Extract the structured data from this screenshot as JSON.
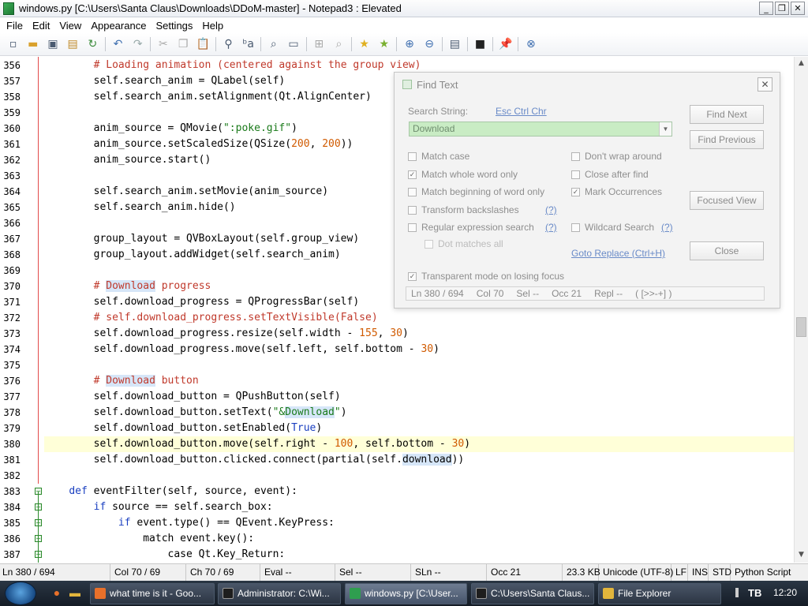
{
  "window": {
    "title": "windows.py [C:\\Users\\Santa Claus\\Downloads\\DDoM-master] - Notepad3 : Elevated",
    "buttons": [
      "_",
      "❐",
      "✕"
    ]
  },
  "menu": [
    "File",
    "Edit",
    "View",
    "Appearance",
    "Settings",
    "Help"
  ],
  "toolbar_icons": [
    "new-icon",
    "open-icon",
    "save-icon",
    "save-all-icon",
    "reload-icon",
    "undo-icon",
    "redo-icon",
    "cut-icon",
    "copy-icon",
    "paste-icon",
    "find-icon",
    "replace-icon",
    "zoom-find-icon",
    "wrap-icon",
    "goto-icon",
    "favorites-icon",
    "add-favorite-icon",
    "zoom-in-icon",
    "zoom-out-icon",
    "scheme-icon",
    "console-icon",
    "pin-icon",
    "close-doc-icon"
  ],
  "editor": {
    "lines": [
      {
        "n": "356",
        "segs": [
          {
            "t": "        "
          },
          {
            "t": "# Loading animation (centered against the group view)",
            "c": "cm"
          }
        ]
      },
      {
        "n": "357",
        "segs": [
          {
            "t": "        self.search_anim = QLabel(self)"
          }
        ]
      },
      {
        "n": "358",
        "segs": [
          {
            "t": "        self.search_anim.setAlignment(Qt.AlignCenter)"
          }
        ]
      },
      {
        "n": "359",
        "segs": []
      },
      {
        "n": "360",
        "segs": [
          {
            "t": "        anim_source = QMovie("
          },
          {
            "t": "\":poke.gif\"",
            "c": "st"
          },
          {
            "t": ")"
          }
        ]
      },
      {
        "n": "361",
        "segs": [
          {
            "t": "        anim_source.setScaledSize(QSize("
          },
          {
            "t": "200",
            "c": "nm"
          },
          {
            "t": ", "
          },
          {
            "t": "200",
            "c": "nm"
          },
          {
            "t": "))"
          }
        ]
      },
      {
        "n": "362",
        "segs": [
          {
            "t": "        anim_source.start()"
          }
        ]
      },
      {
        "n": "363",
        "segs": []
      },
      {
        "n": "364",
        "segs": [
          {
            "t": "        self.search_anim.setMovie(anim_source)"
          }
        ]
      },
      {
        "n": "365",
        "segs": [
          {
            "t": "        self.search_anim.hide()"
          }
        ]
      },
      {
        "n": "366",
        "segs": []
      },
      {
        "n": "367",
        "segs": [
          {
            "t": "        group_layout = QVBoxLayout(self.group_view)"
          }
        ]
      },
      {
        "n": "368",
        "segs": [
          {
            "t": "        group_layout.addWidget(self.search_anim)"
          }
        ]
      },
      {
        "n": "369",
        "segs": []
      },
      {
        "n": "370",
        "segs": [
          {
            "t": "        "
          },
          {
            "t": "# ",
            "c": "cm"
          },
          {
            "t": "Download",
            "c": "cm hl"
          },
          {
            "t": " progress",
            "c": "cm"
          }
        ]
      },
      {
        "n": "371",
        "segs": [
          {
            "t": "        self.download_progress = QProgressBar(self)"
          }
        ]
      },
      {
        "n": "372",
        "segs": [
          {
            "t": "        "
          },
          {
            "t": "# self.download_progress.setTextVisible(False)",
            "c": "cm"
          }
        ]
      },
      {
        "n": "373",
        "segs": [
          {
            "t": "        self.download_progress.resize(self.width - "
          },
          {
            "t": "155",
            "c": "nm"
          },
          {
            "t": ", "
          },
          {
            "t": "30",
            "c": "nm"
          },
          {
            "t": ")"
          }
        ]
      },
      {
        "n": "374",
        "segs": [
          {
            "t": "        self.download_progress.move(self.left, self.bottom - "
          },
          {
            "t": "30",
            "c": "nm"
          },
          {
            "t": ")"
          }
        ]
      },
      {
        "n": "375",
        "segs": []
      },
      {
        "n": "376",
        "segs": [
          {
            "t": "        "
          },
          {
            "t": "# ",
            "c": "cm"
          },
          {
            "t": "Download",
            "c": "cm hl"
          },
          {
            "t": " button",
            "c": "cm"
          }
        ]
      },
      {
        "n": "377",
        "segs": [
          {
            "t": "        self.download_button = QPushButton(self)"
          }
        ]
      },
      {
        "n": "378",
        "segs": [
          {
            "t": "        self.download_button.setText("
          },
          {
            "t": "\"&",
            "c": "st"
          },
          {
            "t": "Download",
            "c": "st hl"
          },
          {
            "t": "\"",
            "c": "st"
          },
          {
            "t": ")"
          }
        ]
      },
      {
        "n": "379",
        "segs": [
          {
            "t": "        self.download_button.setEnabled("
          },
          {
            "t": "True",
            "c": "kw"
          },
          {
            "t": ")"
          }
        ]
      },
      {
        "n": "380",
        "cur": true,
        "segs": [
          {
            "t": "        self.download_button.move(self.right - "
          },
          {
            "t": "100",
            "c": "nm"
          },
          {
            "t": ", self.bottom - "
          },
          {
            "t": "30",
            "c": "nm"
          },
          {
            "t": ")"
          }
        ]
      },
      {
        "n": "381",
        "segs": [
          {
            "t": "        self.download_button.clicked.connect(partial(self."
          },
          {
            "t": "download",
            "c": "hl"
          },
          {
            "t": "))"
          }
        ]
      },
      {
        "n": "382",
        "segs": []
      },
      {
        "n": "383",
        "segs": [
          {
            "t": "    "
          },
          {
            "t": "def",
            "c": "kw"
          },
          {
            "t": " eventFilter(self, source, event):"
          }
        ]
      },
      {
        "n": "384",
        "segs": [
          {
            "t": "        "
          },
          {
            "t": "if",
            "c": "kw"
          },
          {
            "t": " source == self.search_box:"
          }
        ]
      },
      {
        "n": "385",
        "segs": [
          {
            "t": "            "
          },
          {
            "t": "if",
            "c": "kw"
          },
          {
            "t": " event.type() == QEvent.KeyPress:"
          }
        ]
      },
      {
        "n": "386",
        "segs": [
          {
            "t": "                match event.key():"
          }
        ]
      },
      {
        "n": "387",
        "segs": [
          {
            "t": "                    case Qt.Key_Return:"
          }
        ]
      }
    ]
  },
  "find_dialog": {
    "title": "Find Text",
    "close": "✕",
    "search_string_label": "Search String:",
    "esc_link": "Esc Ctrl Chr",
    "search_value": "Download",
    "options_left": [
      {
        "label": "Match case",
        "checked": false
      },
      {
        "label": "Match whole word only",
        "checked": true
      },
      {
        "label": "Match beginning of word only",
        "checked": false
      },
      {
        "label": "Transform backslashes",
        "checked": false,
        "help": "(?)"
      },
      {
        "label": "Regular expression search",
        "checked": false,
        "help": "(?)"
      }
    ],
    "dot_matches": "Dot matches all",
    "options_right": [
      {
        "label": "Don't wrap around",
        "checked": false
      },
      {
        "label": "Close after find",
        "checked": false
      },
      {
        "label": "Mark Occurrences",
        "checked": true
      },
      {
        "label": "Wildcard Search",
        "checked": false,
        "help": "(?)"
      }
    ],
    "goto_replace": "Goto Replace (Ctrl+H)",
    "transparent": {
      "label": "Transparent mode on losing focus",
      "checked": true
    },
    "buttons": {
      "find_next": "Find Next",
      "find_previous": "Find Previous",
      "focused_view": "Focused View",
      "close": "Close"
    },
    "status": [
      "Ln 380 / 694",
      "Col 70",
      "Sel --",
      "Occ 21",
      "Repl --",
      "( [>>-+] )"
    ]
  },
  "statusbar": [
    "Ln 380 / 694",
    "Col 70 / 69",
    "Ch 70 / 69",
    "Eval --",
    "Sel --",
    "SLn --",
    "Occ 21",
    "23.3 KB",
    "Unicode (UTF-8)",
    "LF",
    "INS",
    "STD",
    "Python Script"
  ],
  "taskbar": {
    "tasks": [
      {
        "label": "what time is it - Goo...",
        "color": "#e8702a"
      },
      {
        "label": "Administrator: C:\\Wi...",
        "color": "#1e1e1e"
      },
      {
        "label": "windows.py [C:\\User...",
        "color": "#2f9e4f",
        "active": true
      },
      {
        "label": "C:\\Users\\Santa Claus...",
        "color": "#1e1e1e"
      },
      {
        "label": "File Explorer",
        "color": "#e2b53c"
      }
    ],
    "clock": "12:20",
    "tray_label": "TB"
  }
}
